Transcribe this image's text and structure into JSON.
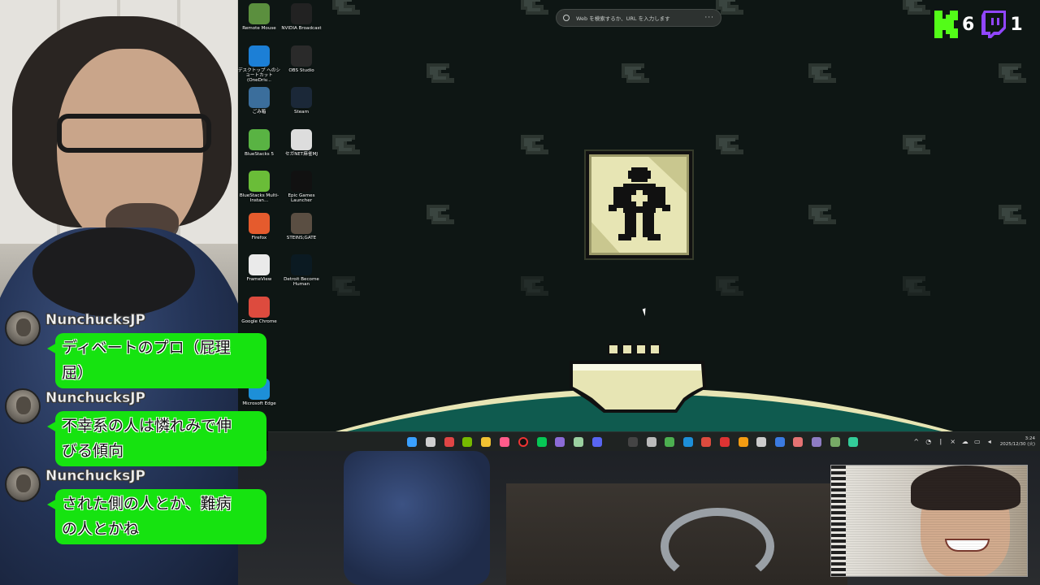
{
  "browser": {
    "search_placeholder": "Web を検索するか、URL を入力します",
    "menu_dots": "···"
  },
  "desktop_icons": [
    {
      "label": "Remote Mouse",
      "icon": "remote-mouse-icon",
      "color": "#5b8f3e"
    },
    {
      "label": "NVIDIA Broadcast",
      "icon": "nvidia-icon",
      "color": "#222"
    },
    {
      "label": "デスクトップ へのショートカット (OneDriv...",
      "icon": "onedrive-icon",
      "color": "#1c7fd6"
    },
    {
      "label": "OBS Studio",
      "icon": "obs-icon",
      "color": "#2a2a2a"
    },
    {
      "label": "ごみ箱",
      "icon": "recycle-bin-icon",
      "color": "#3b6e9c"
    },
    {
      "label": "Steam",
      "icon": "steam-icon",
      "color": "#1b2838"
    },
    {
      "label": "BlueStacks 5",
      "icon": "bluestacks-icon",
      "color": "#59b343"
    },
    {
      "label": "セガNET麻雀MJ",
      "icon": "sega-mj-icon",
      "color": "#ddd"
    },
    {
      "label": "BlueStacks Multi-Instan...",
      "icon": "bluestacks-multi-icon",
      "color": "#6abd38"
    },
    {
      "label": "Epic Games Launcher",
      "icon": "epic-games-icon",
      "color": "#111"
    },
    {
      "label": "Firefox",
      "icon": "firefox-icon",
      "color": "#e55b2d"
    },
    {
      "label": "STEINS;GATE",
      "icon": "steins-gate-icon",
      "color": "#5a4e42"
    },
    {
      "label": "FrameView",
      "icon": "frameview-icon",
      "color": "#eaeaea"
    },
    {
      "label": "Detroit Become Human",
      "icon": "detroit-icon",
      "color": "#0b1a22"
    },
    {
      "label": "Google Chrome",
      "icon": "chrome-icon",
      "color": "#dd4b3e"
    },
    {
      "label": "Microsoft Edge",
      "icon": "edge-icon",
      "color": "#1d8fd8"
    }
  ],
  "counters": {
    "kick_count": "6",
    "twitch_count": "1"
  },
  "chat": [
    {
      "user": "NunchucksJP",
      "lines": [
        "ディベートのプロ（屁理",
        "屈）"
      ]
    },
    {
      "user": "NunchucksJP",
      "lines": [
        "不幸系の人は憐れみで伸",
        "びる傾向"
      ]
    },
    {
      "user": "NunchucksJP",
      "lines": [
        "された側の人とか、難病",
        "の人とかね"
      ]
    }
  ],
  "taskbar": {
    "icons": [
      "start-icon",
      "task-view-icon",
      "obs-taskbar-icon",
      "nvidia-taskbar-icon",
      "file-explorer-icon",
      "app-pink-icon",
      "record-icon",
      "line-icon",
      "app-purple-icon",
      "notepad-icon",
      "discord-icon",
      "app-dark-icon",
      "app-a-icon",
      "xbox-icon",
      "edge-taskbar-icon",
      "chrome-taskbar-icon",
      "app-red-icon",
      "app-orange-icon",
      "app-back-icon",
      "app-blue-icon",
      "app-red2-icon",
      "app-purple2-icon",
      "app-game-icon",
      "app-green-icon"
    ],
    "tray_icons": [
      "chevron-up-icon",
      "network-icon",
      "mic-icon",
      "close-x-icon",
      "onedrive-tray-icon",
      "monitor-icon",
      "volume-icon"
    ],
    "time": "3:24",
    "date": "2025/12/30 (火)"
  },
  "colors": {
    "chat_bubble": "#16e310",
    "kick_green": "#53fc18",
    "twitch_purple": "#9146ff",
    "game_cream": "#e7e5b4",
    "game_teal": "#0f5b4f"
  }
}
